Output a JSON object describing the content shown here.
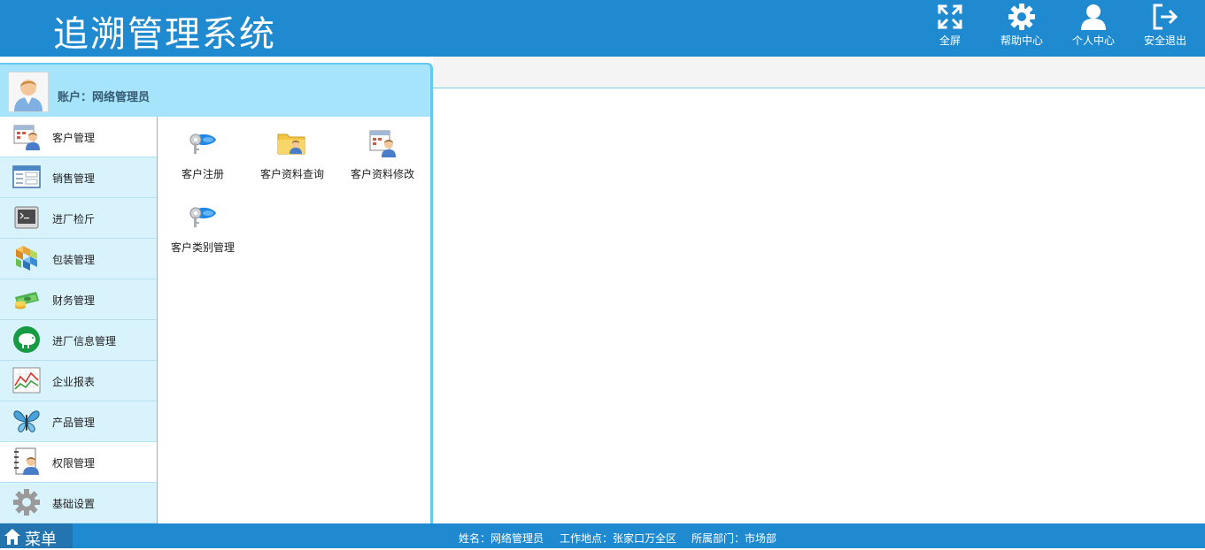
{
  "header": {
    "title": "追溯管理系统",
    "buttons": [
      {
        "label": "全屏",
        "icon": "fullscreen-icon"
      },
      {
        "label": "帮助中心",
        "icon": "gear-icon"
      },
      {
        "label": "个人中心",
        "icon": "user-icon"
      },
      {
        "label": "安全退出",
        "icon": "logout-icon"
      }
    ]
  },
  "account": {
    "label": "账户：网络管理员",
    "icon": "user-avatar-icon"
  },
  "menu": {
    "items": [
      {
        "label": "客户管理",
        "icon": "customer-calendar-icon"
      },
      {
        "label": "销售管理",
        "icon": "sales-window-icon"
      },
      {
        "label": "进厂检斤",
        "icon": "terminal-icon"
      },
      {
        "label": "包装管理",
        "icon": "boxes-icon"
      },
      {
        "label": "财务管理",
        "icon": "money-icon"
      },
      {
        "label": "进厂信息管理",
        "icon": "pig-icon"
      },
      {
        "label": "企业报表",
        "icon": "line-chart-icon"
      },
      {
        "label": "产品管理",
        "icon": "butterfly-icon"
      },
      {
        "label": "权限管理",
        "icon": "notebook-user-icon"
      },
      {
        "label": "基础设置",
        "icon": "settings-gear-icon"
      }
    ]
  },
  "submenu": {
    "items": [
      {
        "label": "客户注册",
        "icon": "key-icon"
      },
      {
        "label": "客户资料查询",
        "icon": "folder-user-icon"
      },
      {
        "label": "客户资料修改",
        "icon": "calendar-user-icon"
      },
      {
        "label": "客户类别管理",
        "icon": "key-icon"
      }
    ]
  },
  "footer": {
    "menu_label": "菜单",
    "menu_icon": "home-icon",
    "name": "姓名：网络管理员",
    "location": "工作地点：张家口万全区",
    "department": "所属部门：市场部"
  },
  "colors": {
    "header": "#1f8ad0",
    "panel_border": "#63c9f0",
    "account_bar": "#a5e4fa",
    "menu_bg": "#d9f3fc"
  }
}
